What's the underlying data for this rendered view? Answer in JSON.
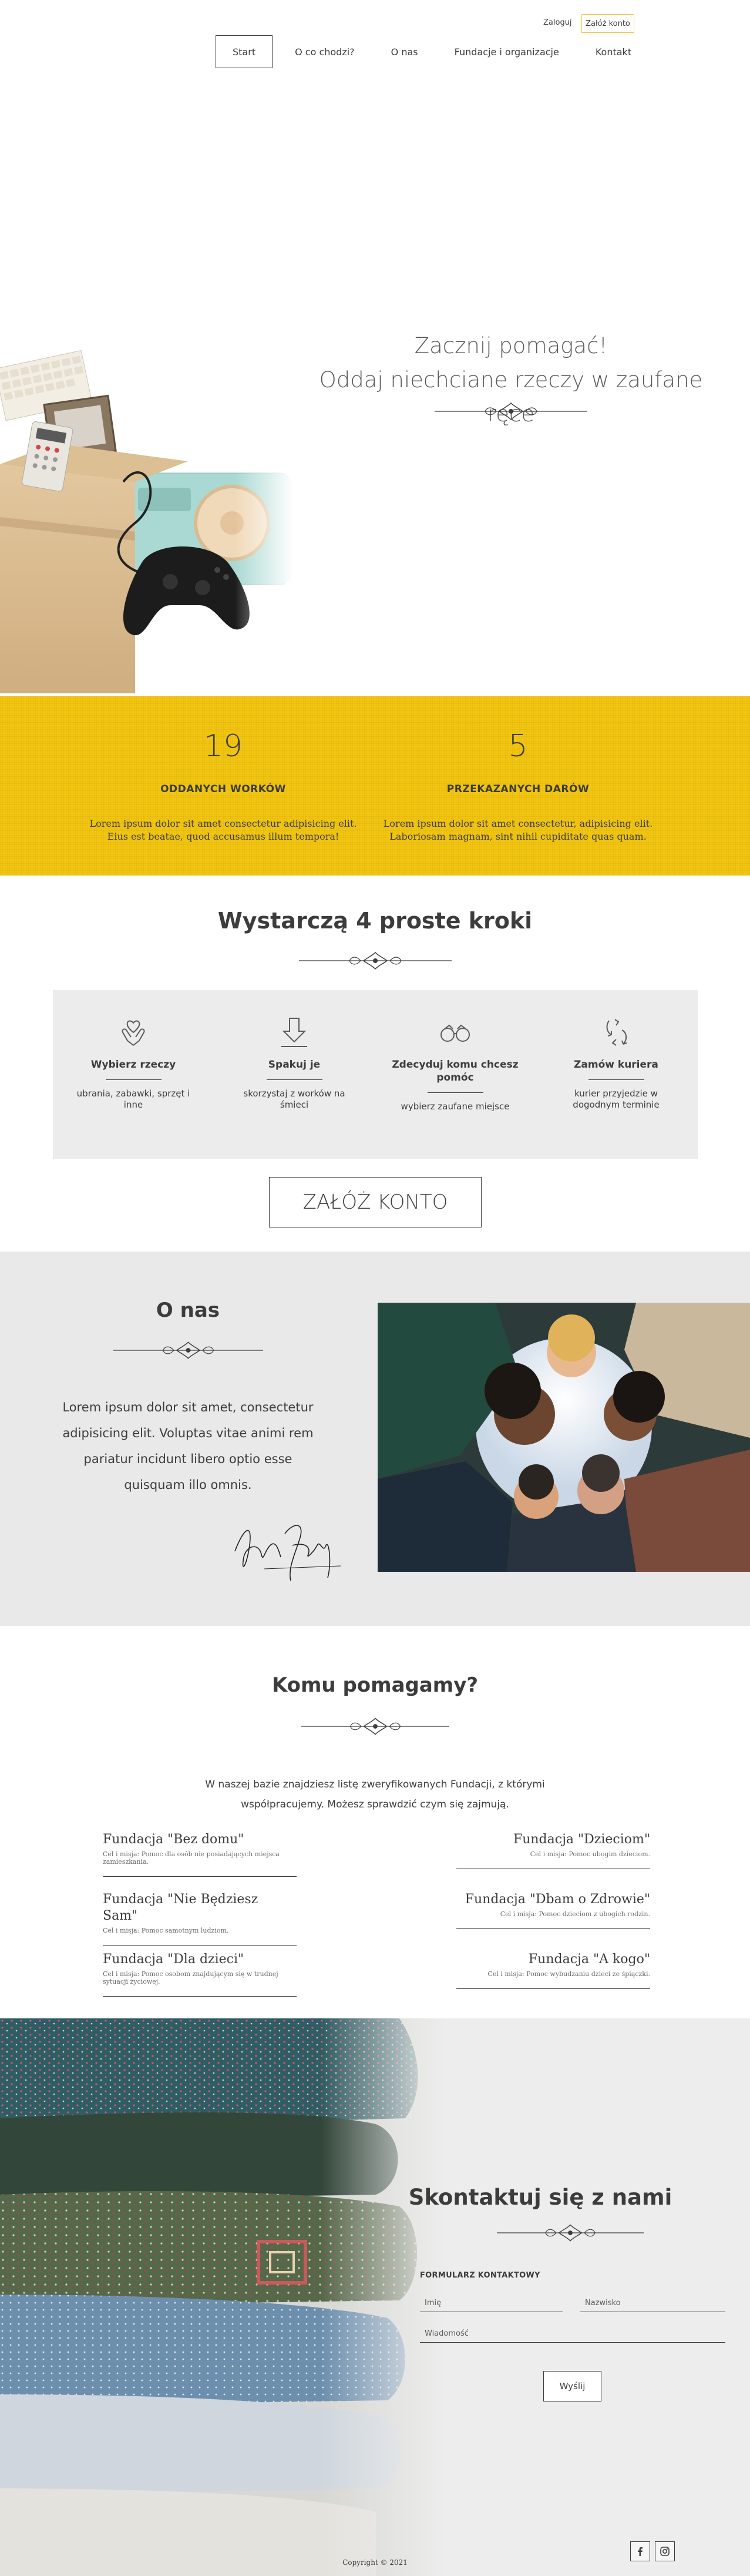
{
  "header": {
    "login": "Zaloguj",
    "register": "Załóż konto",
    "nav": [
      "Start",
      "O co chodzi?",
      "O nas",
      "Fundacje i organizacje",
      "Kontakt"
    ]
  },
  "hero": {
    "line1": "Zacznij pomagać!",
    "line2": "Oddaj niechciane rzeczy w zaufane ręce"
  },
  "stats": [
    {
      "number": "19",
      "label": "ODDANYCH WORKÓW",
      "desc_line1": "Lorem ipsum dolor sit amet consectetur adipisicing elit.",
      "desc_line2": "Eius est beatae, quod accusamus illum tempora!"
    },
    {
      "number": "5",
      "label": "PRZEKAZANYCH DARÓW",
      "desc_line1": "Lorem ipsum dolor sit amet consectetur, adipisicing elit.",
      "desc_line2": "Laboriosam magnam, sint nihil cupiditate quas quam."
    }
  ],
  "steps": {
    "title": "Wystarczą 4 proste kroki",
    "items": [
      {
        "icon": "hands-heart-icon",
        "title": "Wybierz rzeczy",
        "desc": "ubrania, zabawki, sprzęt i inne"
      },
      {
        "icon": "download-arrow-icon",
        "title": "Spakuj je",
        "desc": "skorzystaj z worków na śmieci"
      },
      {
        "icon": "binoculars-icon",
        "title": "Zdecyduj komu chcesz pomóc",
        "desc": "wybierz zaufane miejsce"
      },
      {
        "icon": "recycle-arrows-icon",
        "title": "Zamów kuriera",
        "desc": "kurier przyjedzie w dogodnym terminie"
      }
    ],
    "cta": "ZAŁÓŻ KONTO"
  },
  "about": {
    "title": "O nas",
    "text": "Lorem ipsum dolor sit amet, consectetur adipisicing elit. Voluptas vitae animi rem pariatur incidunt libero optio esse quisquam illo omnis."
  },
  "help": {
    "title": "Komu pomagamy?",
    "intro_line1": "W naszej bazie znajdziesz listę zweryfikowanych Fundacji, z którymi",
    "intro_line2": "współpracujemy. Możesz sprawdzić czym się zajmują.",
    "left": [
      {
        "name": "Fundacja \"Bez domu\"",
        "desc": "Cel i misja: Pomoc dla osób nie posiadających miejsca zamieszkania."
      },
      {
        "name": "Fundacja \"Nie Będziesz Sam\"",
        "desc": "Cel i misja: Pomoc samotnym ludziom."
      },
      {
        "name": "Fundacja \"Dla dzieci\"",
        "desc": "Cel i misja: Pomoc osobom znajdującym się w trudnej sytuacji życiowej."
      }
    ],
    "right": [
      {
        "name": "Fundacja \"Dzieciom\"",
        "desc": "Cel i misja: Pomoc ubogim dzieciom."
      },
      {
        "name": "Fundacja \"Dbam o Zdrowie\"",
        "desc": "Cel i misja: Pomoc dzieciom z ubogich rodzin."
      },
      {
        "name": "Fundacja \"A kogo\"",
        "desc": "Cel i misja: Pomoc wybudzaniu dzieci ze śpiączki."
      }
    ]
  },
  "contact": {
    "title": "Skontaktuj się z nami",
    "form_label": "FORMULARZ KONTAKTOWY",
    "name_placeholder": "Imię",
    "surname_placeholder": "Nazwisko",
    "message_placeholder": "Wiadomość",
    "send": "Wyślij",
    "copyright": "Copyright © 2021"
  },
  "colors": {
    "accent": "#f2c511",
    "text": "#3c3c3c",
    "panel": "#ececec"
  }
}
